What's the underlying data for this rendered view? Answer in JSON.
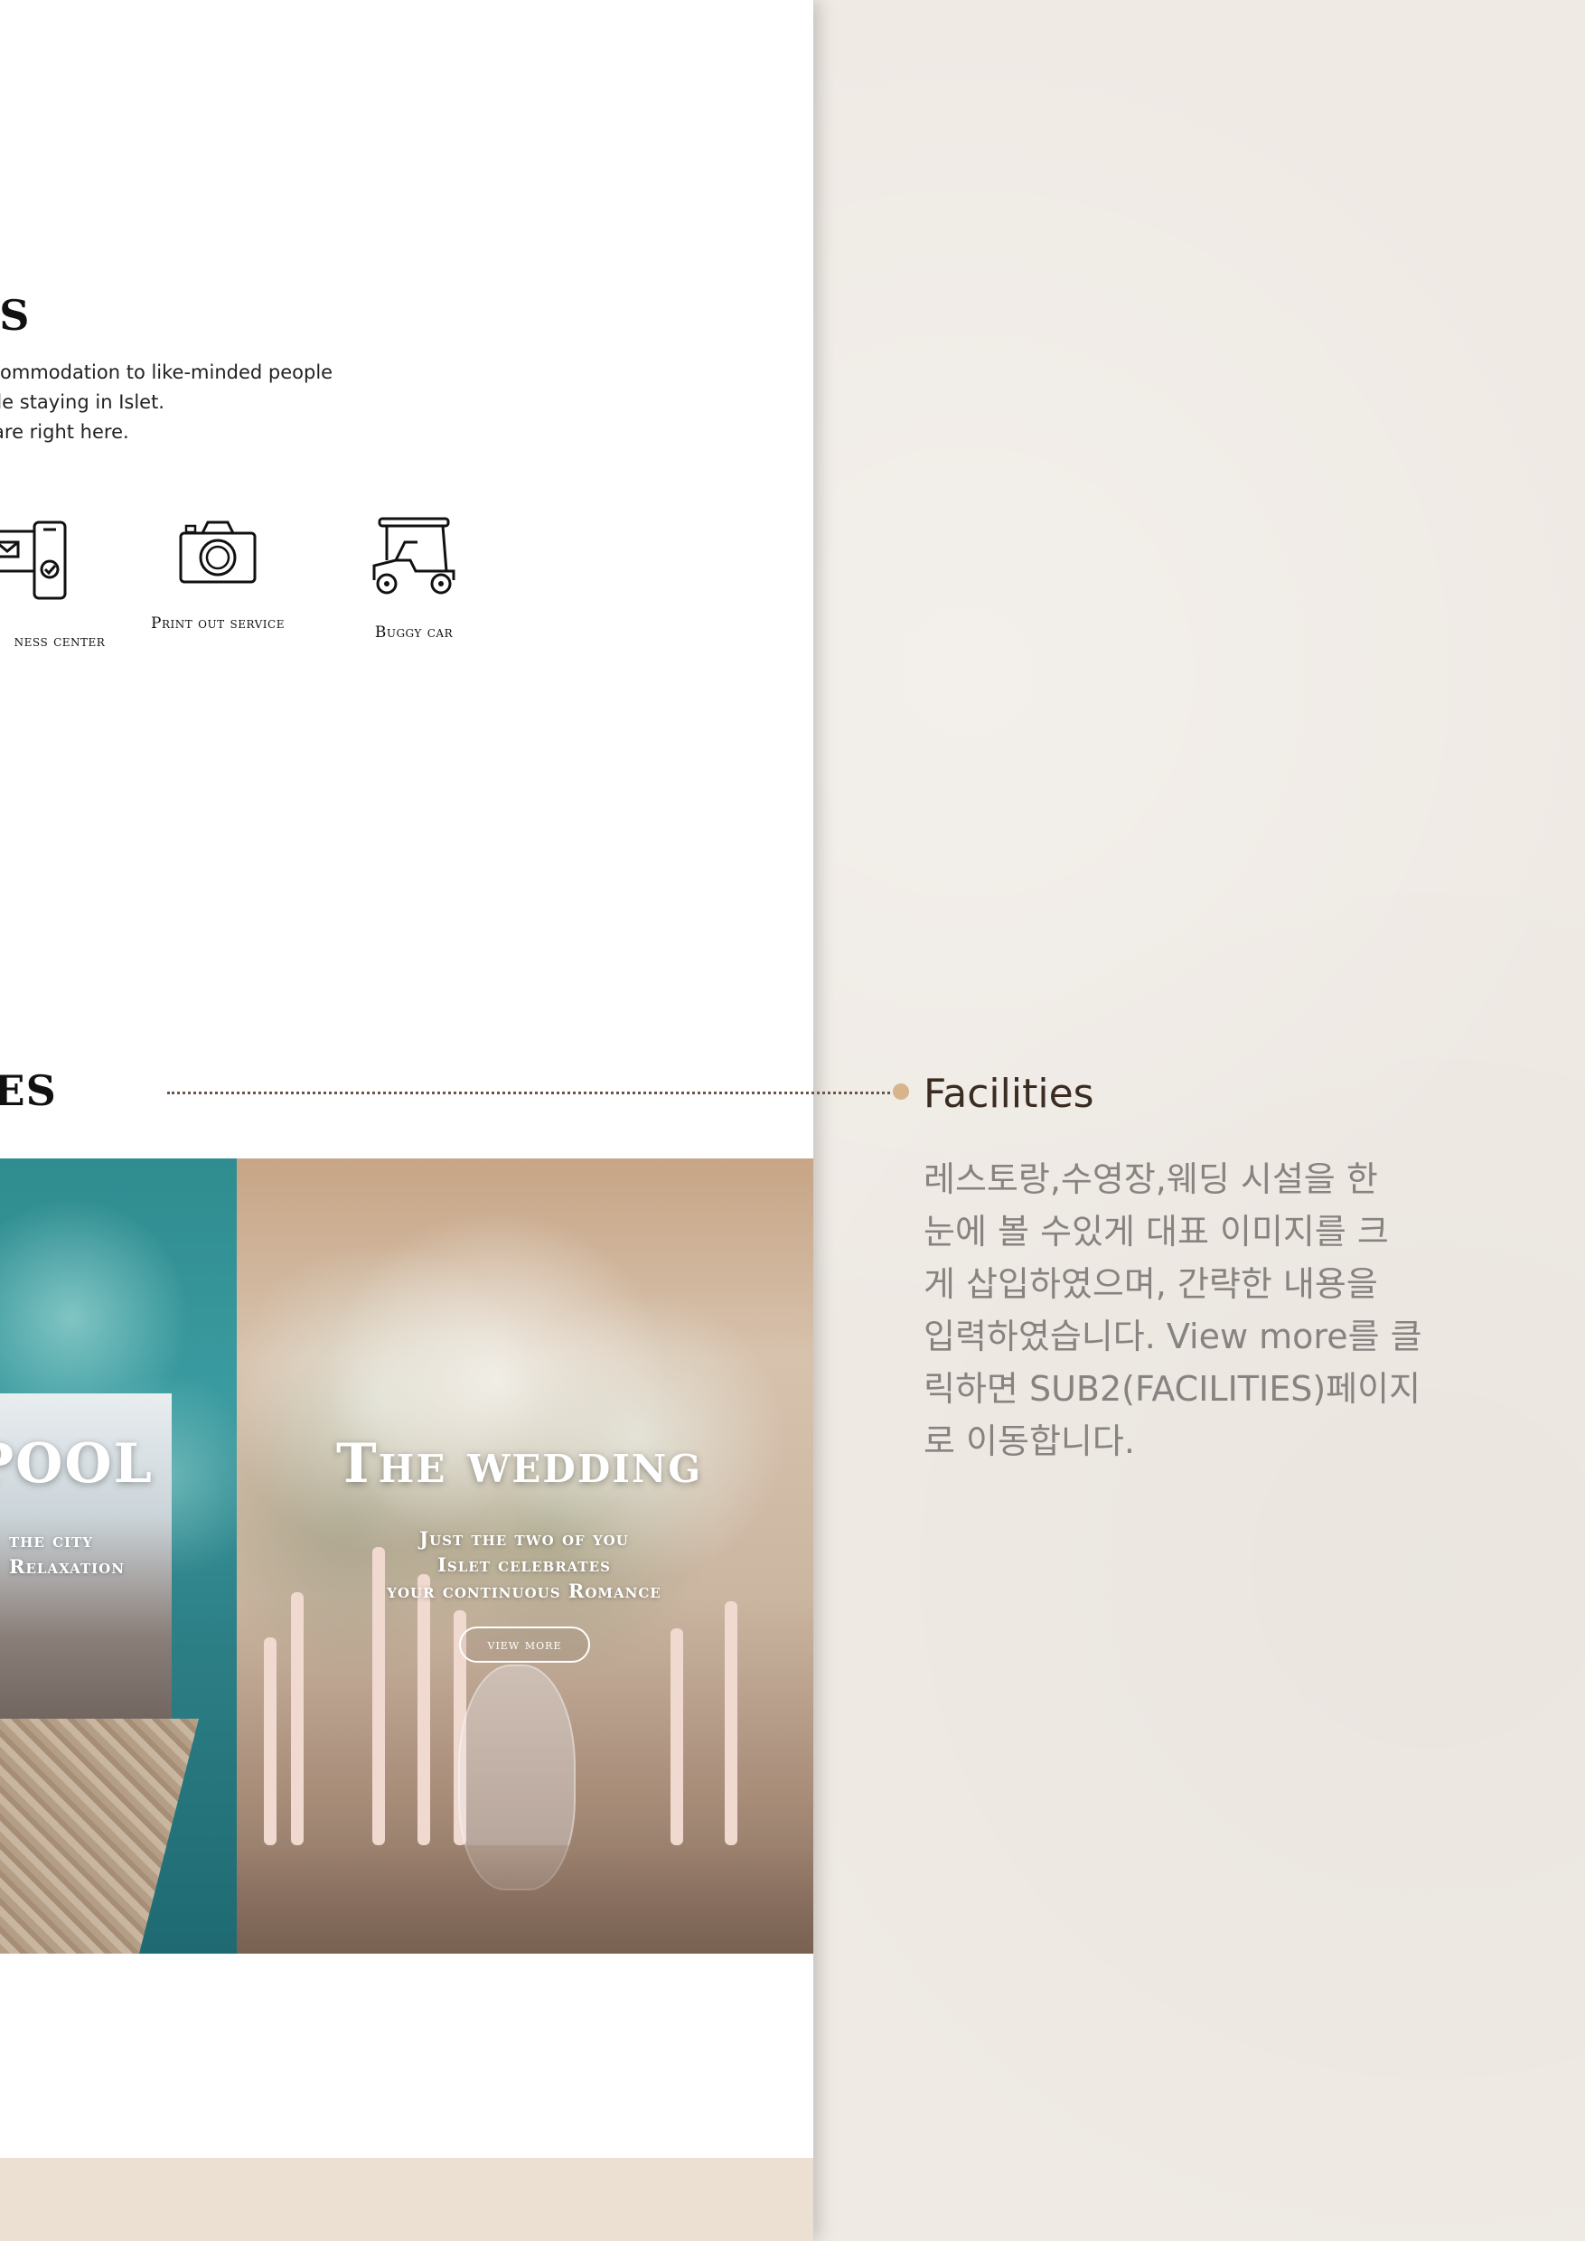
{
  "others": {
    "title": "RS",
    "desc": [
      "ommodation to like-minded people",
      " while staying in Islet.",
      "ve are right here."
    ],
    "amenities": [
      {
        "label": "ness center",
        "icon": "business-center-icon"
      },
      {
        "label": "Print out service",
        "icon": "camera-icon"
      },
      {
        "label": "Buggy car",
        "icon": "buggy-car-icon"
      }
    ]
  },
  "facilities": {
    "title": "IES",
    "pool": {
      "title": "POOL",
      "sub": [
        "the city",
        "Relaxation"
      ]
    },
    "wedding": {
      "title": "The wedding",
      "sub": [
        "Just the two of you",
        "Islet celebrates",
        "your continuous Romance"
      ],
      "view_more": "view more"
    }
  },
  "annotation": {
    "title": "Facilities",
    "body": "레스토랑,수영장,웨딩 시설을 한\n눈에 볼 수있게 대표 이미지를 크\n게 삽입하였으며, 간략한 내용을\n입력하였습니다. View more를 클\n릭하면 SUB2(FACILITIES)페이지\n로 이동합니다."
  },
  "colors": {
    "paper": "#efeae4",
    "connector_line": "#6b5447",
    "connector_dot": "#d8b48c",
    "peach_band": "#ece0d3",
    "annotation_title": "#3b2c22",
    "annotation_body": "#888280"
  }
}
